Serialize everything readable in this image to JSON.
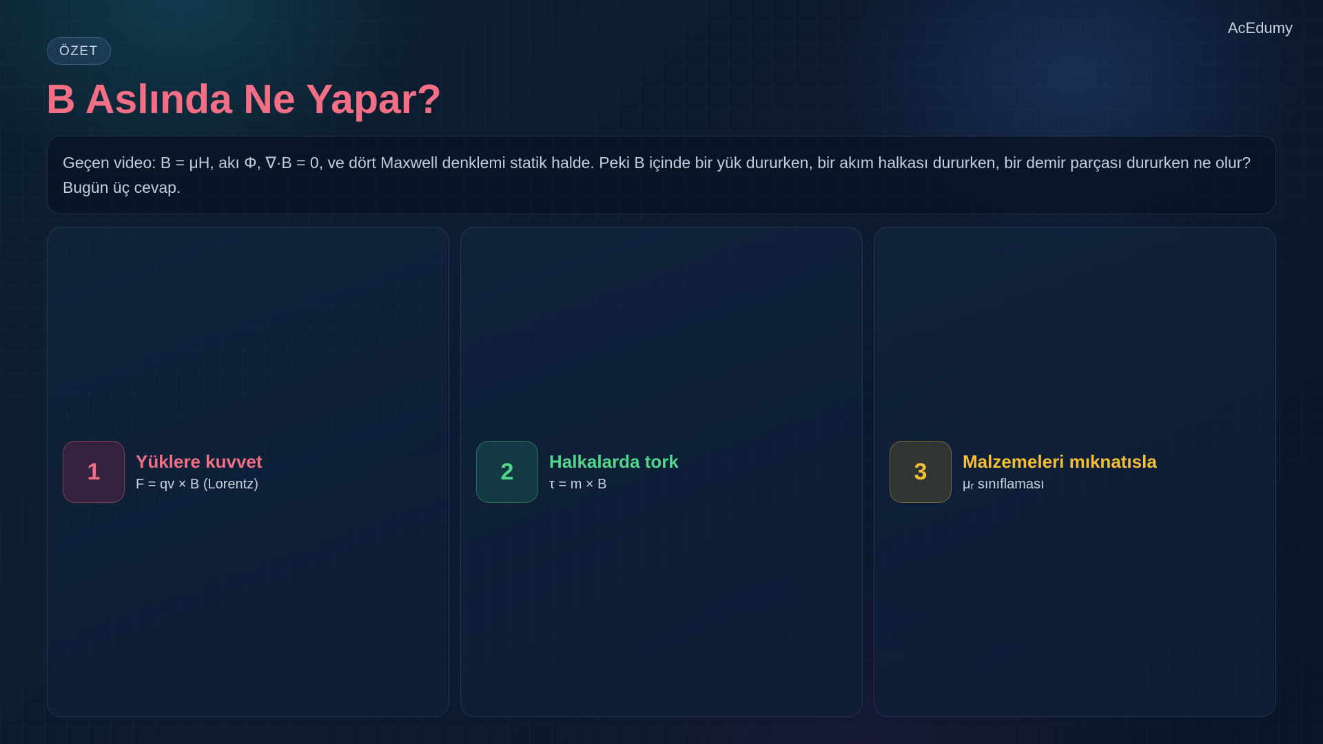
{
  "brand": "AcEdumy",
  "tag": "ÖZET",
  "title": "B Aslında Ne Yapar?",
  "intro": "Geçen video: B = μH, akı Φ, ∇·B = 0, ve dört Maxwell denklemi statik halde. Peki B içinde bir yük dururken, bir akım halkası dururken, bir demir parçası dururken ne olur? Bugün üç cevap.",
  "cards": [
    {
      "number": "1",
      "title": "Yüklere kuvvet",
      "subtitle": "F = qv × B (Lorentz)",
      "color": "#f36f85"
    },
    {
      "number": "2",
      "title": "Halkalarda tork",
      "subtitle": "τ = m × B",
      "color": "#52d68a"
    },
    {
      "number": "3",
      "title": "Malzemeleri mıknatısla",
      "subtitle": "μᵣ sınıflaması",
      "color": "#f4be35"
    }
  ]
}
